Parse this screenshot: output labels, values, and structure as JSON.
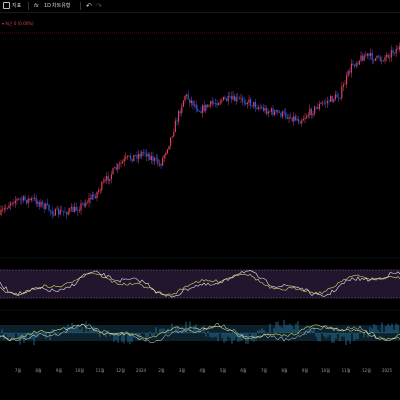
{
  "toolbar": {
    "indicator_label": "지표",
    "fx_label": "fx",
    "interval_label": "1D",
    "type_label": "차트유형"
  },
  "price_label": "▾ 최근 0 (0.00%)",
  "x_axis_labels": [
    "7월",
    "8월",
    "9월",
    "10월",
    "11월",
    "12월",
    "2024",
    "2월",
    "3월",
    "4월",
    "5월",
    "6월",
    "7월",
    "8월",
    "9월",
    "10월",
    "11월",
    "12월",
    "2025"
  ],
  "colors": {
    "background": "#000000",
    "candle_up": "#e0405a",
    "candle_down": "#3a58e0",
    "price_line": "#8a2030",
    "osc_band_fill": "#2a1a3a",
    "osc_line_1": "#d6d870",
    "osc_line_2": "#e8e8e8",
    "macd_band_fill": "#0d2530",
    "macd_line": "#3aa0d8",
    "signal_line": "#d6d870"
  }
}
